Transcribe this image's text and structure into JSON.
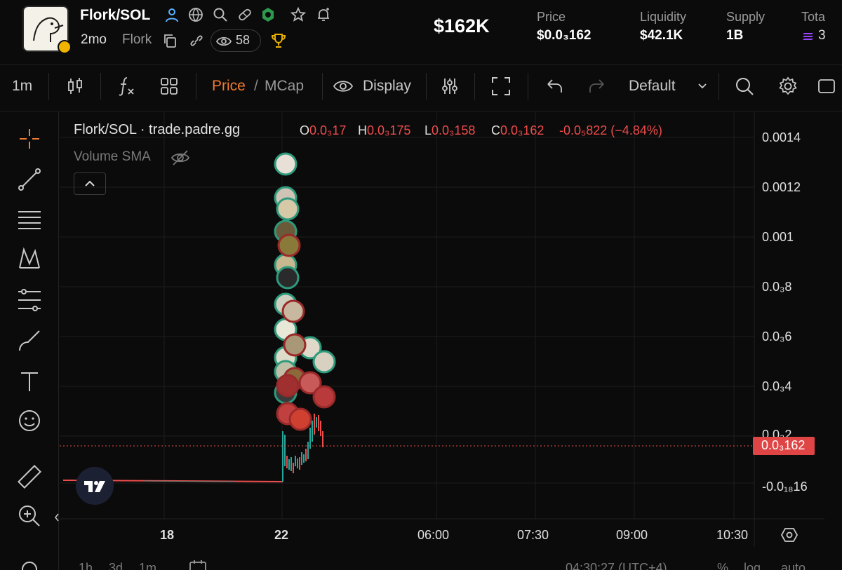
{
  "header": {
    "pair_title": "Flork/SOL",
    "age": "2mo",
    "ticker": "Flork",
    "watchers": "58",
    "market_cap": "$162K",
    "stats": [
      {
        "label": "Price",
        "value": "$0.0₃162"
      },
      {
        "label": "Liquidity",
        "value": "$42.1K"
      },
      {
        "label": "Supply",
        "value": "1B"
      },
      {
        "label": "Tota",
        "value": "3"
      }
    ],
    "icons": [
      "user-icon",
      "globe-icon",
      "search-icon",
      "pill-icon",
      "badge-icon",
      "star-icon",
      "bell-add-icon",
      "copy-icon",
      "link-icon",
      "eye-icon",
      "trophy-icon"
    ]
  },
  "toolbar": {
    "interval": "1m",
    "price_label": "Price",
    "separator": "/",
    "mcap_label": "MCap",
    "display_label": "Display",
    "layout_label": "Default",
    "accent_color": "#f07b32"
  },
  "legend": {
    "symbol": "Flork/SOL · trade.padre.gg",
    "open_key": "O",
    "open": "0.0₃17",
    "high_key": "H",
    "high": "0.0₃175",
    "low_key": "L",
    "low": "0.0₃158",
    "close_key": "C",
    "close": "0.0₃162",
    "change": "-0.0₅822 (−4.84%)",
    "volume_label": "Volume SMA"
  },
  "axes": {
    "y_ticks": [
      "0.0014",
      "0.0012",
      "0.001",
      "0.0₃8",
      "0.0₃6",
      "0.0₃4",
      "0.0₃2",
      "-0.0₁₈16"
    ],
    "x_ticks": [
      "18",
      "22",
      "06:00",
      "07:30",
      "09:00",
      "10:30"
    ],
    "current_price": "0.0₃162"
  },
  "bottom": {
    "ranges": [
      "1h",
      "3d",
      "1m"
    ],
    "time": "04:30:27 (UTC+4)",
    "options": [
      "%",
      "log",
      "auto"
    ]
  },
  "colors": {
    "up": "#26a69a",
    "down": "#ef4c4c",
    "background": "#0b0b0b"
  }
}
